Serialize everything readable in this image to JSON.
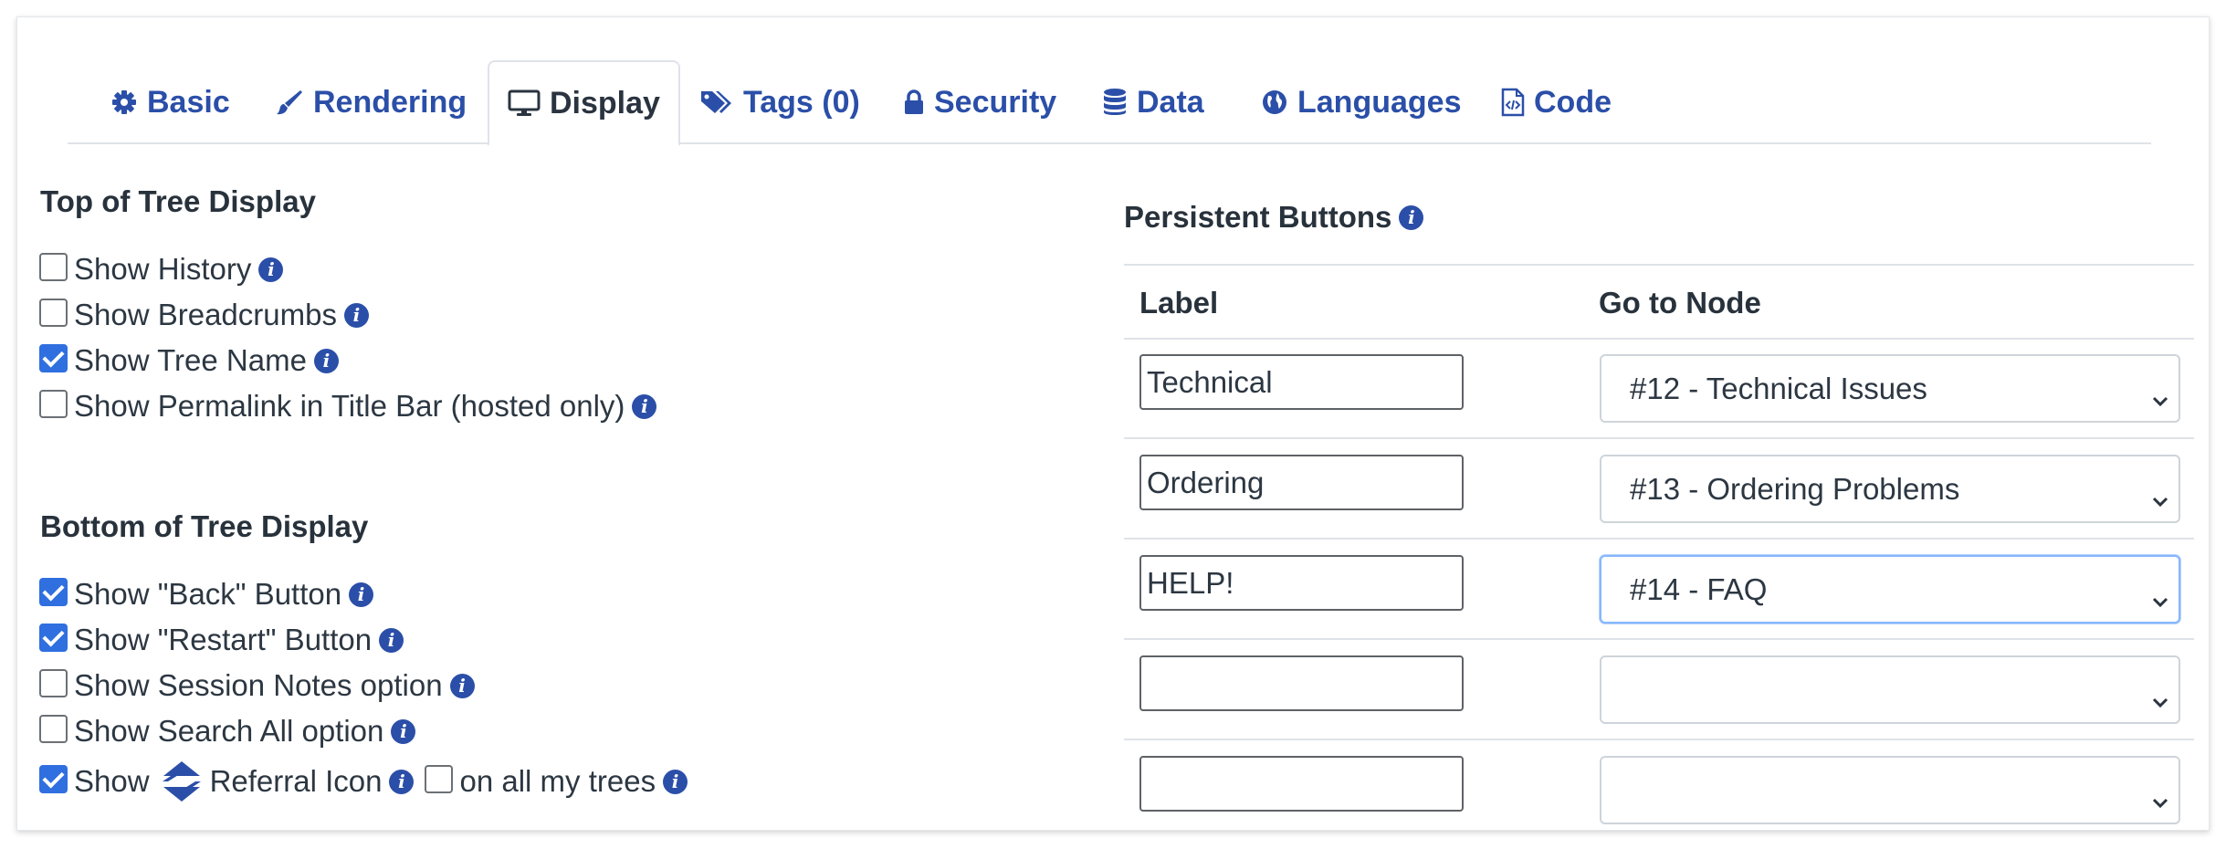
{
  "tabs": [
    {
      "label": "Basic",
      "icon": "gear-icon"
    },
    {
      "label": "Rendering",
      "icon": "paintbrush-icon"
    },
    {
      "label": "Display",
      "icon": "monitor-icon",
      "active": true
    },
    {
      "label": "Tags (0)",
      "icon": "tags-icon"
    },
    {
      "label": "Security",
      "icon": "lock-icon"
    },
    {
      "label": "Data",
      "icon": "database-icon"
    },
    {
      "label": "Languages",
      "icon": "globe-icon"
    },
    {
      "label": "Code",
      "icon": "code-file-icon"
    }
  ],
  "top_display": {
    "title": "Top of Tree Display",
    "options": [
      {
        "label": "Show History",
        "checked": false
      },
      {
        "label": "Show Breadcrumbs",
        "checked": false
      },
      {
        "label": "Show Tree Name",
        "checked": true
      },
      {
        "label": "Show Permalink in Title Bar (hosted only)",
        "checked": false
      }
    ]
  },
  "bottom_display": {
    "title": "Bottom of Tree Display",
    "options": [
      {
        "label": "Show \"Back\" Button",
        "checked": true
      },
      {
        "label": "Show \"Restart\" Button",
        "checked": true
      },
      {
        "label": "Show Session Notes option",
        "checked": false
      },
      {
        "label": "Show Search All option",
        "checked": false
      }
    ],
    "referral": {
      "show_label": "Show",
      "icon": "referral-arrows-icon",
      "referral_label": "Referral Icon",
      "checked": true,
      "all_trees_label": "on all my trees",
      "all_trees_checked": false
    }
  },
  "persistent_buttons": {
    "title": "Persistent Buttons",
    "label_header": "Label",
    "node_header": "Go to Node",
    "rows": [
      {
        "label": "Technical",
        "node": "#12 - Technical Issues"
      },
      {
        "label": "Ordering",
        "node": "#13 - Ordering Problems"
      },
      {
        "label": "HELP!",
        "node": "#14 - FAQ"
      },
      {
        "label": "",
        "node": ""
      },
      {
        "label": "",
        "node": ""
      }
    ]
  },
  "colors": {
    "accent": "#2b4fa8",
    "checkbox": "#2f6fe0",
    "text": "#2c3742"
  }
}
